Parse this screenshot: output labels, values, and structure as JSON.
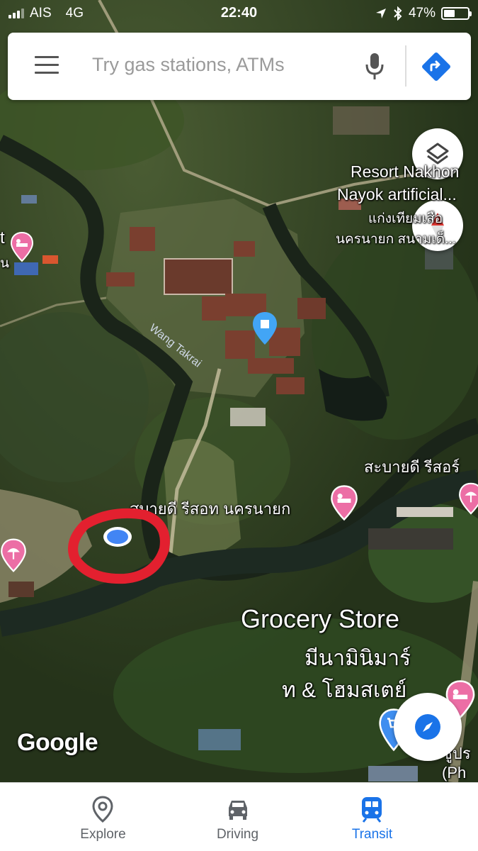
{
  "status_bar": {
    "carrier": "AIS",
    "network": "4G",
    "time": "22:40",
    "battery_text": "47%",
    "battery_level": 0.47
  },
  "search": {
    "placeholder": "Try gas stations, ATMs"
  },
  "map": {
    "labels": {
      "resort_nakhon_line1": "Resort Nakhon",
      "resort_nakhon_line2": "Nayok artificial...",
      "resort_nakhon_thai_line1": "แก่งเทียมเสือ",
      "resort_nakhon_thai_line2": "นครนายก สนามเด็...",
      "left_edge_t": "t",
      "left_edge_n": "น",
      "river_name": "Wang Takrai",
      "sabai_dee": "สบายดี รีสอท นครนายก",
      "sabai_dee_right": "สะบายดี รีสอร์",
      "grocery_title": "Grocery Store",
      "grocery_thai_line1": "มีนามินิมาร์",
      "grocery_thai_line2": "ท & โฮมสเตย์",
      "bottom_right_thai": "ซูปร",
      "bottom_right_paren": "(Ph"
    },
    "attribution": "Google",
    "colors": {
      "pin_blue": "#42a5f5",
      "pin_pink": "#ec6ea5",
      "location_dot": "#4285f4",
      "annotation_red": "#e3202f"
    }
  },
  "bottom_nav": {
    "items": [
      {
        "label": "Explore",
        "icon": "location-pin-icon"
      },
      {
        "label": "Driving",
        "icon": "car-icon"
      },
      {
        "label": "Transit",
        "icon": "train-icon",
        "active": true
      }
    ]
  }
}
